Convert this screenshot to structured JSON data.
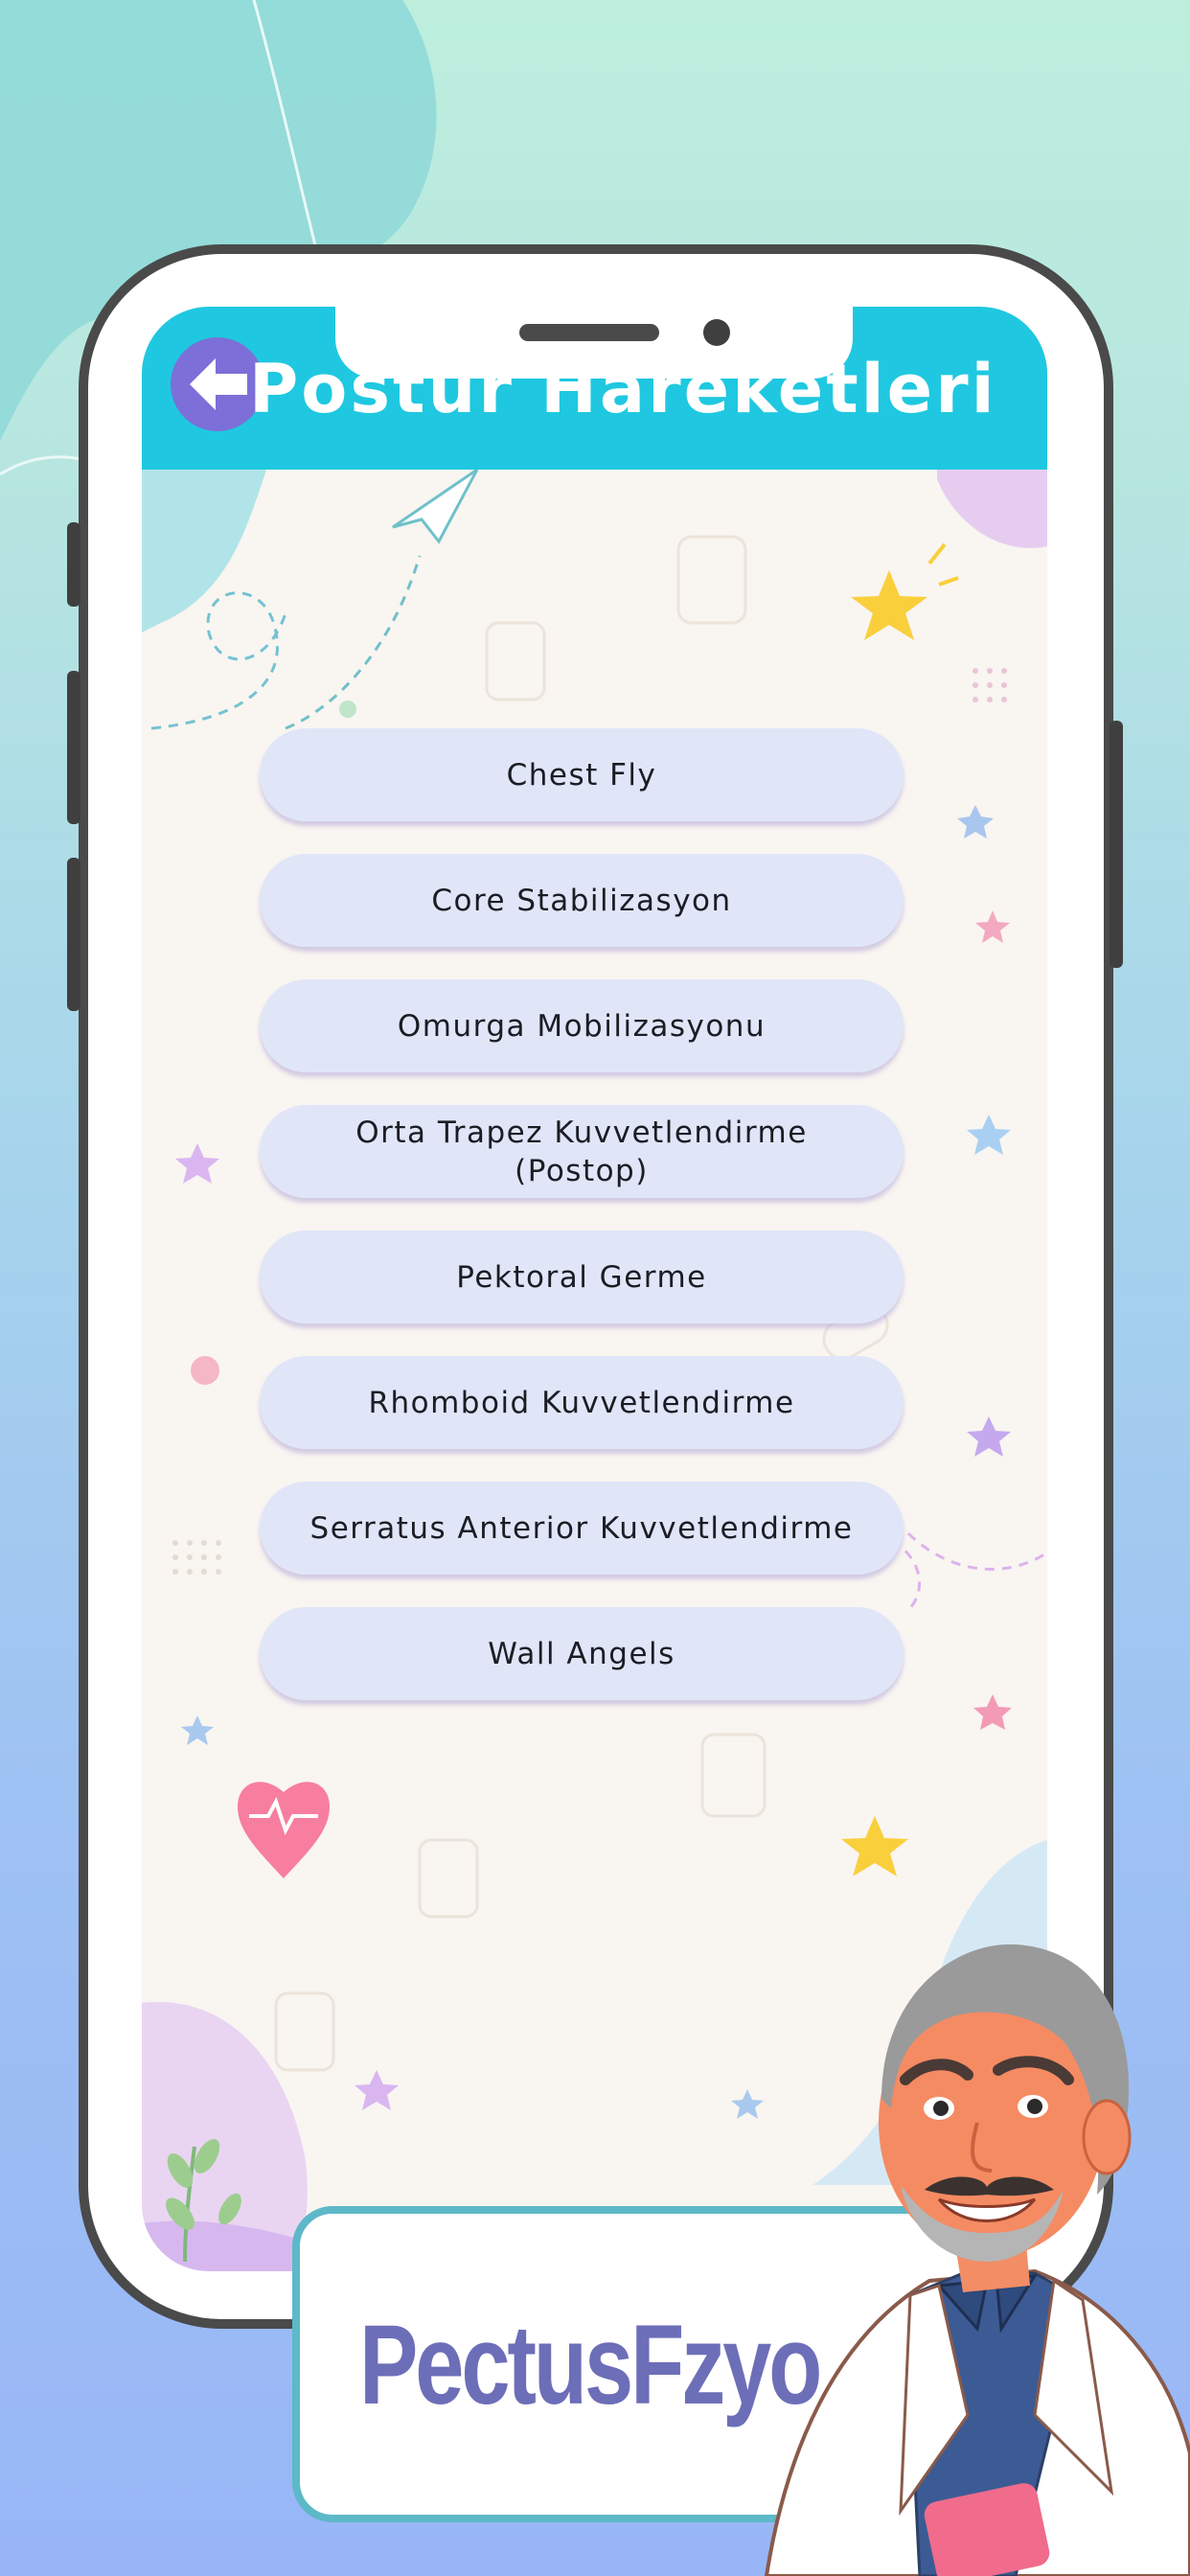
{
  "header": {
    "title": "Postur Hareketleri"
  },
  "exercises": [
    {
      "label": "Chest Fly"
    },
    {
      "label": "Core Stabilizasyon"
    },
    {
      "label": "Omurga Mobilizasyonu"
    },
    {
      "label": "Orta Trapez Kuvvetlendirme\n(Postop)"
    },
    {
      "label": "Pektoral Germe"
    },
    {
      "label": "Rhomboid Kuvvetlendirme"
    },
    {
      "label": "Serratus Anterior Kuvvetlendirme"
    },
    {
      "label": "Wall Angels"
    }
  ],
  "brand": {
    "name": "PectusFzyo"
  },
  "colors": {
    "title_bar": "#1fc8e0",
    "back_button": "#7c6fd8",
    "menu_item_bg": "#e0e6f8",
    "brand_text": "#6d6eb8",
    "brand_border": "#5db8c8"
  },
  "icons": {
    "back": "arrow-left-icon"
  }
}
